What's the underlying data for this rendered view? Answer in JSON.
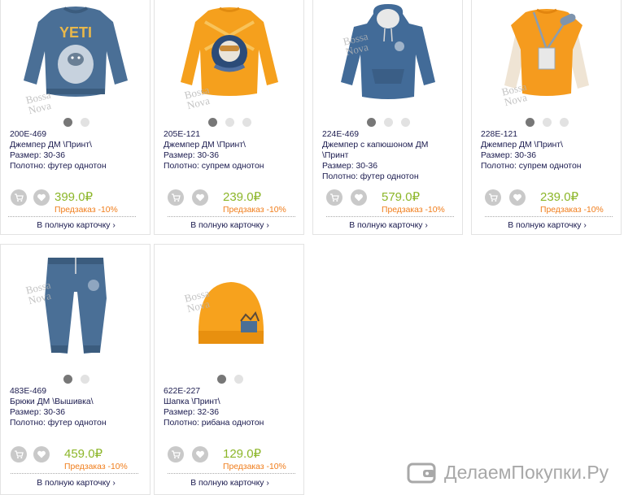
{
  "products": [
    {
      "sku": "200E-469",
      "name": "Джемпер ДМ \\Принт\\",
      "size": "Размер: 30-36",
      "fabric": "Полотно: футер однотон",
      "price": "399.0₽",
      "preorder": "Предзаказ -10%",
      "link": "В полную карточку ›",
      "image": "blue-sweatshirt-yeti-print",
      "dots_total": 2,
      "dot_active": 1
    },
    {
      "sku": "205E-121",
      "name": "Джемпер ДМ \\Принт\\",
      "size": "Размер: 30-36",
      "fabric": "Полотно: супрем однотон",
      "price": "239.0₽",
      "preorder": "Предзаказ -10%",
      "link": "В полную карточку ›",
      "image": "orange-longsleeve-bear-print",
      "dots_total": 3,
      "dot_active": 1
    },
    {
      "sku": "224E-469",
      "name": "Джемпер с капюшоном ДМ \\Принт",
      "size": "Размер: 30-36",
      "fabric": "Полотно: футер однотон",
      "price": "579.0₽",
      "preorder": "Предзаказ -10%",
      "link": "В полную карточку ›",
      "image": "blue-hoodie",
      "dots_total": 3,
      "dot_active": 1
    },
    {
      "sku": "228E-121",
      "name": "Джемпер ДМ \\Принт\\",
      "size": "Размер: 30-36",
      "fabric": "Полотно: супрем однотон",
      "price": "239.0₽",
      "preorder": "Предзаказ -10%",
      "link": "В полную карточку ›",
      "image": "orange-layered-longsleeve",
      "dots_total": 3,
      "dot_active": 1
    },
    {
      "sku": "483E-469",
      "name": "Брюки ДМ \\Вышивка\\",
      "size": "Размер: 30-36",
      "fabric": "Полотно: футер однотон",
      "price": "459.0₽",
      "preorder": "Предзаказ -10%",
      "link": "В полную карточку ›",
      "image": "blue-sweatpants",
      "dots_total": 2,
      "dot_active": 1
    },
    {
      "sku": "622E-227",
      "name": "Шапка \\Принт\\",
      "size": "Размер: 32-36",
      "fabric": "Полотно: рибана однотон",
      "price": "129.0₽",
      "preorder": "Предзаказ -10%",
      "link": "В полную карточку ›",
      "image": "orange-beanie",
      "dots_total": 2,
      "dot_active": 1
    }
  ],
  "brand_watermark": [
    "Bossa",
    "Nova"
  ],
  "yeti_print_text": "YETI",
  "site_watermark": "ДелаемПокупки.Ру",
  "icons": {
    "cart": "cart-icon",
    "wishlist": "heart-icon",
    "site": "wallet-icon"
  },
  "colors": {
    "price": "#8cb629",
    "preorder": "#f07d1b",
    "text": "#1a1a4e",
    "icon_bg": "#c9c9c9",
    "card_border": "#e3e3e3"
  }
}
